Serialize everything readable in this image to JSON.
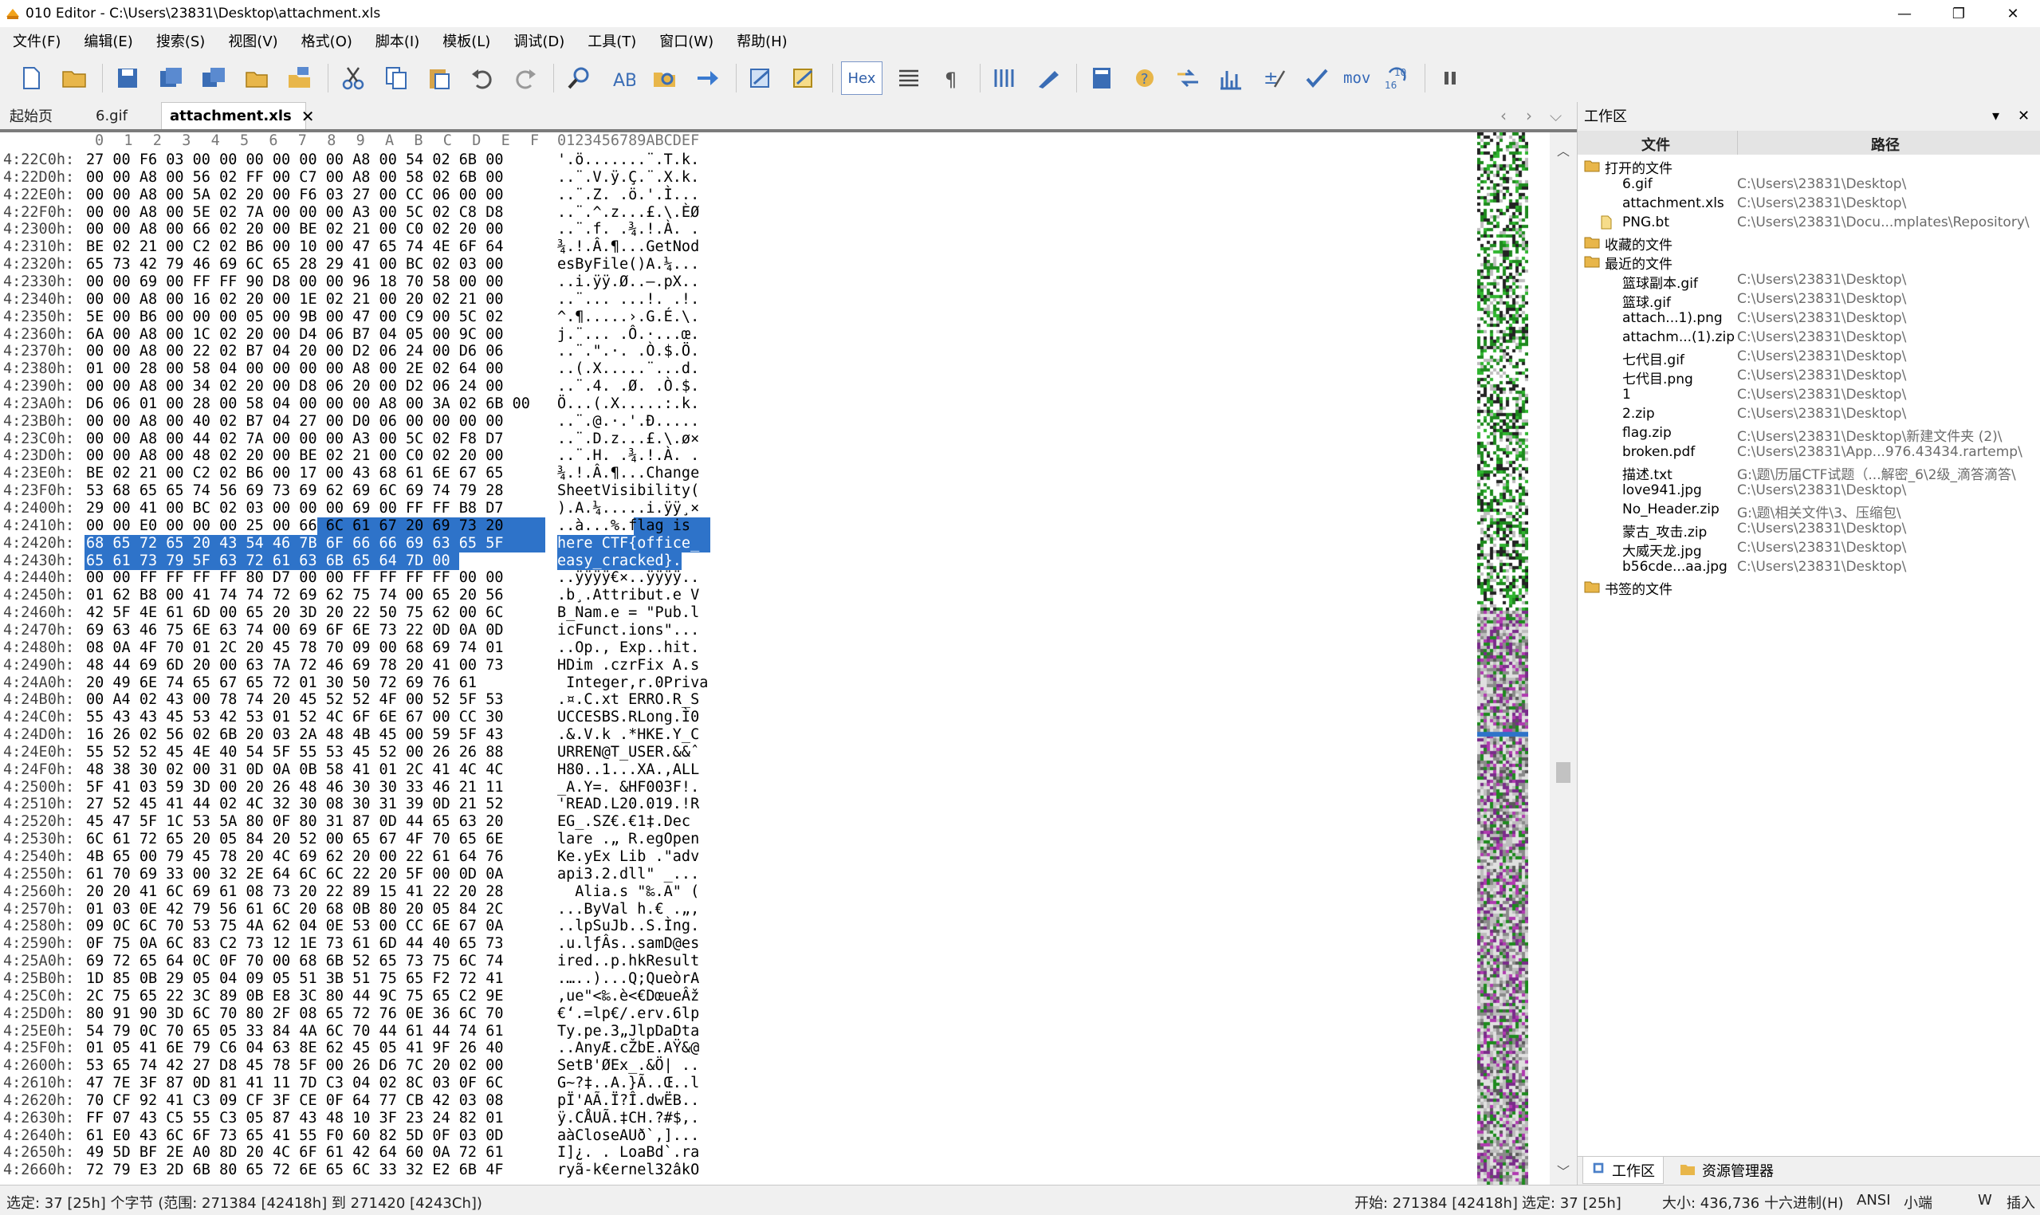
{
  "window": {
    "title": "010 Editor - C:\\Users\\23831\\Desktop\\attachment.xls",
    "minimize": "—",
    "maximize": "❐",
    "close": "✕"
  },
  "menu": [
    "文件(F)",
    "编辑(E)",
    "搜索(S)",
    "视图(V)",
    "格式(O)",
    "脚本(I)",
    "模板(L)",
    "调试(D)",
    "工具(T)",
    "窗口(W)",
    "帮助(H)"
  ],
  "toolbar": {
    "hex_label": "Hex",
    "mov_label": "mov",
    "icons": [
      "new-file-icon",
      "open-folder-icon",
      "save-icon",
      "save-as-icon",
      "save-all-icon",
      "open-folder-small-icon",
      "copy-files-icon",
      "cut-icon",
      "copy-icon",
      "paste-icon",
      "undo-icon",
      "redo-icon",
      "find-icon",
      "replace-icon",
      "find-in-files-icon",
      "goto-icon",
      "script-icon",
      "template-icon",
      "hex-mode-icon",
      "columns-icon",
      "paragraph-icon",
      "table-icon",
      "highlight-icon",
      "calculator-icon",
      "inspector-icon",
      "compare-icon",
      "histogram-icon",
      "checksum-icon",
      "verify-icon",
      "disassembler-icon",
      "base-convert-icon",
      "pause-icon"
    ]
  },
  "tabs": [
    {
      "label": "起始页"
    },
    {
      "label": "6.gif"
    },
    {
      "label": "attachment.xls",
      "close": "✕"
    }
  ],
  "hex": {
    "column_header": [
      "0",
      "1",
      "2",
      "3",
      "4",
      "5",
      "6",
      "7",
      "8",
      "9",
      "A",
      "B",
      "C",
      "D",
      "E",
      "F"
    ],
    "ascii_header": "0123456789ABCDEF",
    "rows": [
      {
        "addr": "4:22C0h:",
        "bytes": "27 00 F6 03 00 00 00 00 00 00 A8 00 54 02 6B 00",
        "ascii": "'.ö.......¨.T.k."
      },
      {
        "addr": "4:22D0h:",
        "bytes": "00 00 A8 00 56 02 FF 00 C7 00 A8 00 58 02 6B 00",
        "ascii": "..¨.V.ÿ.Ç.¨.X.k."
      },
      {
        "addr": "4:22E0h:",
        "bytes": "00 00 A8 00 5A 02 20 00 F6 03 27 00 CC 06 00 00",
        "ascii": "..¨.Z. .ö.'.Ì..."
      },
      {
        "addr": "4:22F0h:",
        "bytes": "00 00 A8 00 5E 02 7A 00 00 00 A3 00 5C 02 C8 D8",
        "ascii": "..¨.^.z...£.\\.ÈØ"
      },
      {
        "addr": "4:2300h:",
        "bytes": "00 00 A8 00 66 02 20 00 BE 02 21 00 C0 02 20 00",
        "ascii": "..¨.f. .¾.!.À. ."
      },
      {
        "addr": "4:2310h:",
        "bytes": "BE 02 21 00 C2 02 B6 00 10 00 47 65 74 4E 6F 64",
        "ascii": "¾.!.Â.¶...GetNod"
      },
      {
        "addr": "4:2320h:",
        "bytes": "65 73 42 79 46 69 6C 65 28 29 41 00 BC 02 03 00",
        "ascii": "esByFile()A.¼..."
      },
      {
        "addr": "4:2330h:",
        "bytes": "00 00 69 00 FF FF 90 D8 00 00 96 18 70 58 00 00",
        "ascii": "..i.ÿÿ.Ø..–.pX.."
      },
      {
        "addr": "4:2340h:",
        "bytes": "00 00 A8 00 16 02 20 00 1E 02 21 00 20 02 21 00",
        "ascii": "..¨... ...!. .!."
      },
      {
        "addr": "4:2350h:",
        "bytes": "5E 00 B6 00 00 00 05 00 9B 00 47 00 C9 00 5C 02",
        "ascii": "^.¶.....›.G.É.\\."
      },
      {
        "addr": "4:2360h:",
        "bytes": "6A 00 A8 00 1C 02 20 00 D4 06 B7 04 05 00 9C 00",
        "ascii": "j.¨... .Ô.·...œ."
      },
      {
        "addr": "4:2370h:",
        "bytes": "00 00 A8 00 22 02 B7 04 20 00 D2 06 24 00 D6 06",
        "ascii": "..¨.\".·. .Ò.$.Ö."
      },
      {
        "addr": "4:2380h:",
        "bytes": "01 00 28 00 58 04 00 00 00 00 A8 00 2E 02 64 00",
        "ascii": "..(.X.....¨...d."
      },
      {
        "addr": "4:2390h:",
        "bytes": "00 00 A8 00 34 02 20 00 D8 06 20 00 D2 06 24 00",
        "ascii": "..¨.4. .Ø. .Ò.$."
      },
      {
        "addr": "4:23A0h:",
        "bytes": "D6 06 01 00 28 00 58 04 00 00 00 A8 00 3A 02 6B 00",
        "ascii": "Ö...(.X.....:.k."
      },
      {
        "addr": "4:23B0h:",
        "bytes": "00 00 A8 00 40 02 B7 04 27 00 D0 06 00 00 00 00",
        "ascii": "..¨.@.·.'.Ð....."
      },
      {
        "addr": "4:23C0h:",
        "bytes": "00 00 A8 00 44 02 7A 00 00 00 A3 00 5C 02 F8 D7",
        "ascii": "..¨.D.z...£.\\.ø×"
      },
      {
        "addr": "4:23D0h:",
        "bytes": "00 00 A8 00 48 02 20 00 BE 02 21 00 C0 02 20 00",
        "ascii": "..¨.H. .¾.!.À. ."
      },
      {
        "addr": "4:23E0h:",
        "bytes": "BE 02 21 00 C2 02 B6 00 17 00 43 68 61 6E 67 65",
        "ascii": "¾.!.Â.¶...Change"
      },
      {
        "addr": "4:23F0h:",
        "bytes": "53 68 65 65 74 56 69 73 69 62 69 6C 69 74 79 28",
        "ascii": "SheetVisibility("
      },
      {
        "addr": "4:2400h:",
        "bytes": "29 00 41 00 BC 02 03 00 00 00 69 00 FF FF B8 D7",
        "ascii": ").A.¼.....i.ÿÿ¸×"
      },
      {
        "addr": "4:2410h:",
        "bytes": "00 00 E0 00 00 00 25 00 66 6C 61 67 20 69 73 20",
        "ascii": "..à...%.flag is "
      },
      {
        "addr": "4:2420h:",
        "bytes": "68 65 72 65 20 43 54 46 7B 6F 66 66 69 63 65 5F",
        "ascii": "here CTF{office_"
      },
      {
        "addr": "4:2430h:",
        "bytes": "65 61 73 79 5F 63 72 61 63 6B 65 64 7D 00 00 00",
        "ascii": "easy_cracked}..."
      },
      {
        "addr": "4:2440h:",
        "bytes": "00 00 FF FF FF FF 80 D7 00 00 FF FF FF FF 00 00",
        "ascii": "..ÿÿÿÿ€×..ÿÿÿÿ.."
      },
      {
        "addr": "4:2450h:",
        "bytes": "01 62 B8 00 41 74 74 72 69 62 75 74 00 65 20 56",
        "ascii": ".b¸.Attribut.e V"
      },
      {
        "addr": "4:2460h:",
        "bytes": "42 5F 4E 61 6D 00 65 20 3D 20 22 50 75 62 00 6C",
        "ascii": "B_Nam.e = \"Pub.l"
      },
      {
        "addr": "4:2470h:",
        "bytes": "69 63 46 75 6E 63 74 00 69 6F 6E 73 22 0D 0A 0D",
        "ascii": "icFunct.ions\"..."
      },
      {
        "addr": "4:2480h:",
        "bytes": "08 0A 4F 70 01 2C 20 45 78 70 09 00 68 69 74 01",
        "ascii": "..Op., Exp..hit."
      },
      {
        "addr": "4:2490h:",
        "bytes": "48 44 69 6D 20 00 63 7A 72 46 69 78 20 41 00 73",
        "ascii": "HDim .czrFix A.s"
      },
      {
        "addr": "4:24A0h:",
        "bytes": "20 49 6E 74 65 67 65 72 01 30 50 72 69 76 61",
        "ascii": " Integer,r.0Priva"
      },
      {
        "addr": "4:24B0h:",
        "bytes": "00 A4 02 43 00 78 74 20 45 52 52 4F 00 52 5F 53",
        "ascii": ".¤.C.xt ERRO.R_S"
      },
      {
        "addr": "4:24C0h:",
        "bytes": "55 43 43 45 53 42 53 01 52 4C 6F 6E 67 00 CC 30",
        "ascii": "UCCESBS.RLong.Ì0"
      },
      {
        "addr": "4:24D0h:",
        "bytes": "16 26 02 56 02 6B 20 03 2A 48 4B 45 00 59 5F 43",
        "ascii": ".&.V.k .*HKE.Y_C"
      },
      {
        "addr": "4:24E0h:",
        "bytes": "55 52 52 45 4E 40 54 5F 55 53 45 52 00 26 26 88",
        "ascii": "URREN@T_USER.&&ˆ"
      },
      {
        "addr": "4:24F0h:",
        "bytes": "48 38 30 02 00 31 0D 0A 0B 58 41 01 2C 41 4C 4C",
        "ascii": "H80..1...XA.,ALL"
      },
      {
        "addr": "4:2500h:",
        "bytes": "5F 41 03 59 3D 00 20 26 48 46 30 30 33 46 21 11",
        "ascii": "_A.Y=. &HF003F!."
      },
      {
        "addr": "4:2510h:",
        "bytes": "27 52 45 41 44 02 4C 32 30 08 30 31 39 0D 21 52",
        "ascii": "'READ.L20.019.!R"
      },
      {
        "addr": "4:2520h:",
        "bytes": "45 47 5F 1C 53 5A 80 0F 80 31 87 0D 44 65 63 20",
        "ascii": "EG_.SZ€.€1‡.Dec "
      },
      {
        "addr": "4:2530h:",
        "bytes": "6C 61 72 65 20 05 84 20 52 00 65 67 4F 70 65 6E",
        "ascii": "lare .„ R.egOpen"
      },
      {
        "addr": "4:2540h:",
        "bytes": "4B 65 00 79 45 78 20 4C 69 62 20 00 22 61 64 76",
        "ascii": "Ke.yEx Lib .\"adv"
      },
      {
        "addr": "4:2550h:",
        "bytes": "61 70 69 33 00 32 2E 64 6C 6C 22 20 5F 00 0D 0A",
        "ascii": "api3.2.dll\" _..."
      },
      {
        "addr": "4:2560h:",
        "bytes": "20 20 41 6C 69 61 08 73 20 22 89 15 41 22 20 28",
        "ascii": "  Alia.s \"‰.A\" ("
      },
      {
        "addr": "4:2570h:",
        "bytes": "01 03 0E 42 79 56 61 6C 20 68 0B 80 20 05 84 2C",
        "ascii": "...ByVal h.€ .„,"
      },
      {
        "addr": "4:2580h:",
        "bytes": "09 0C 6C 70 53 75 4A 62 04 0E 53 00 CC 6E 67 0A",
        "ascii": "..lpSuJb..S.Ìng."
      },
      {
        "addr": "4:2590h:",
        "bytes": "0F 75 0A 6C 83 C2 73 12 1E 73 61 6D 44 40 65 73",
        "ascii": ".u.lƒÂs..samD@es"
      },
      {
        "addr": "4:25A0h:",
        "bytes": "69 72 65 64 0C 0F 70 00 68 6B 52 65 73 75 6C 74",
        "ascii": "ired..p.hkResult"
      },
      {
        "addr": "4:25B0h:",
        "bytes": "1D 85 0B 29 05 04 09 05 51 3B 51 75 65 F2 72 41",
        "ascii": ".…..)...Q;QueòrA"
      },
      {
        "addr": "4:25C0h:",
        "bytes": "2C 75 65 22 3C 89 0B E8 3C 80 44 9C 75 65 C2 9E",
        "ascii": ",ue\"<‰.è<€DœueÂž"
      },
      {
        "addr": "4:25D0h:",
        "bytes": "80 91 90 3D 6C 70 80 2F 08 65 72 76 0E 36 6C 70",
        "ascii": "€‘.=lp€/.erv.6lp"
      },
      {
        "addr": "4:25E0h:",
        "bytes": "54 79 0C 70 65 05 33 84 4A 6C 70 44 61 44 74 61",
        "ascii": "Ty.pe.3„JlpDaDta"
      },
      {
        "addr": "4:25F0h:",
        "bytes": "01 05 41 6E 79 C6 04 63 8E 62 45 05 41 9F 26 40",
        "ascii": "..AnyÆ.cŽbE.AŸ&@"
      },
      {
        "addr": "4:2600h:",
        "bytes": "53 65 74 42 27 D8 45 78 5F 00 26 D6 7C 20 02 00",
        "ascii": "SetB'ØEx_.&Ö| .."
      },
      {
        "addr": "4:2610h:",
        "bytes": "47 7E 3F 87 0D 81 41 11 7D C3 04 02 8C 03 0F 6C",
        "ascii": "G~?‡..A.}Ã..Œ..l"
      },
      {
        "addr": "4:2620h:",
        "bytes": "70 CF 92 41 C3 09 CF 3F CE 0F 64 77 CB 42 03 08",
        "ascii": "pÏ'AÃ.Ï?Î.dwËB.."
      },
      {
        "addr": "4:2630h:",
        "bytes": "FF 07 43 C5 55 C3 05 87 43 48 10 3F 23 24 82 01",
        "ascii": "ÿ.CÅUÃ.‡CH.?#$‚."
      },
      {
        "addr": "4:2640h:",
        "bytes": "61 E0 43 6C 6F 73 65 41 55 F0 60 82 5D 0F 03 0D",
        "ascii": "aàCloseAUð`‚]..."
      },
      {
        "addr": "4:2650h:",
        "bytes": "49 5D BF 2E A0 8D 20 4C 6F 61 42 64 60 0A 72 61",
        "ascii": "I]¿. . LoaBd`.ra"
      },
      {
        "addr": "4:2660h:",
        "bytes": "72 79 E3 2D 6B 80 65 72 6E 65 6C 33 32 E2 6B 4F",
        "ascii": "ryã-k€ernel32âkO"
      }
    ]
  },
  "workspace": {
    "title": "工作区",
    "col_file": "文件",
    "col_path": "路径",
    "open_files_label": "打开的文件",
    "open_files": [
      {
        "name": "6.gif",
        "path": "C:\\Users\\23831\\Desktop\\"
      },
      {
        "name": "attachment.xls",
        "path": "C:\\Users\\23831\\Desktop\\"
      },
      {
        "name": "PNG.bt",
        "path": "C:\\Users\\23831\\Docu...mplates\\Repository\\"
      }
    ],
    "favorites_label": "收藏的文件",
    "recent_label": "最近的文件",
    "recent_files": [
      {
        "name": "篮球副本.gif",
        "path": "C:\\Users\\23831\\Desktop\\"
      },
      {
        "name": "篮球.gif",
        "path": "C:\\Users\\23831\\Desktop\\"
      },
      {
        "name": "attach...1).png",
        "path": "C:\\Users\\23831\\Desktop\\"
      },
      {
        "name": "attachm...(1).zip",
        "path": "C:\\Users\\23831\\Desktop\\"
      },
      {
        "name": "七代目.gif",
        "path": "C:\\Users\\23831\\Desktop\\"
      },
      {
        "name": "七代目.png",
        "path": "C:\\Users\\23831\\Desktop\\"
      },
      {
        "name": "1",
        "path": "C:\\Users\\23831\\Desktop\\"
      },
      {
        "name": "2.zip",
        "path": "C:\\Users\\23831\\Desktop\\"
      },
      {
        "name": "flag.zip",
        "path": "C:\\Users\\23831\\Desktop\\新建文件夹 (2)\\"
      },
      {
        "name": "broken.pdf",
        "path": "C:\\Users\\23831\\App...976.43434.rartemp\\"
      },
      {
        "name": "描述.txt",
        "path": "G:\\题\\历届CTF试题（...解密_6\\2级_滴答滴答\\"
      },
      {
        "name": "love941.jpg",
        "path": "C:\\Users\\23831\\Desktop\\"
      },
      {
        "name": "No_Header.zip",
        "path": "G:\\题\\相关文件\\3、压缩包\\"
      },
      {
        "name": "蒙古_攻击.zip",
        "path": "C:\\Users\\23831\\Desktop\\"
      },
      {
        "name": "大威天龙.jpg",
        "path": "C:\\Users\\23831\\Desktop\\"
      },
      {
        "name": "b56cde...aa.jpg",
        "path": "C:\\Users\\23831\\Desktop\\"
      }
    ],
    "bookmarks_label": "书签的文件",
    "bottom_tabs": [
      "工作区",
      "资源管理器"
    ]
  },
  "status": {
    "selection": "选定: 37 [25h] 个字节 (范围: 271384 [42418h] 到 271420 [4243Ch])",
    "start": "开始: 271384 [42418h]",
    "sel_short": "选定: 37 [25h]",
    "size": "大小: 436,736",
    "mode": "十六进制(H)",
    "encoding": "ANSI",
    "endian": "小端",
    "w": "W",
    "insert": "插入"
  },
  "colors": {
    "selection": "#2e73c9",
    "accent": "#2f5ea8"
  }
}
